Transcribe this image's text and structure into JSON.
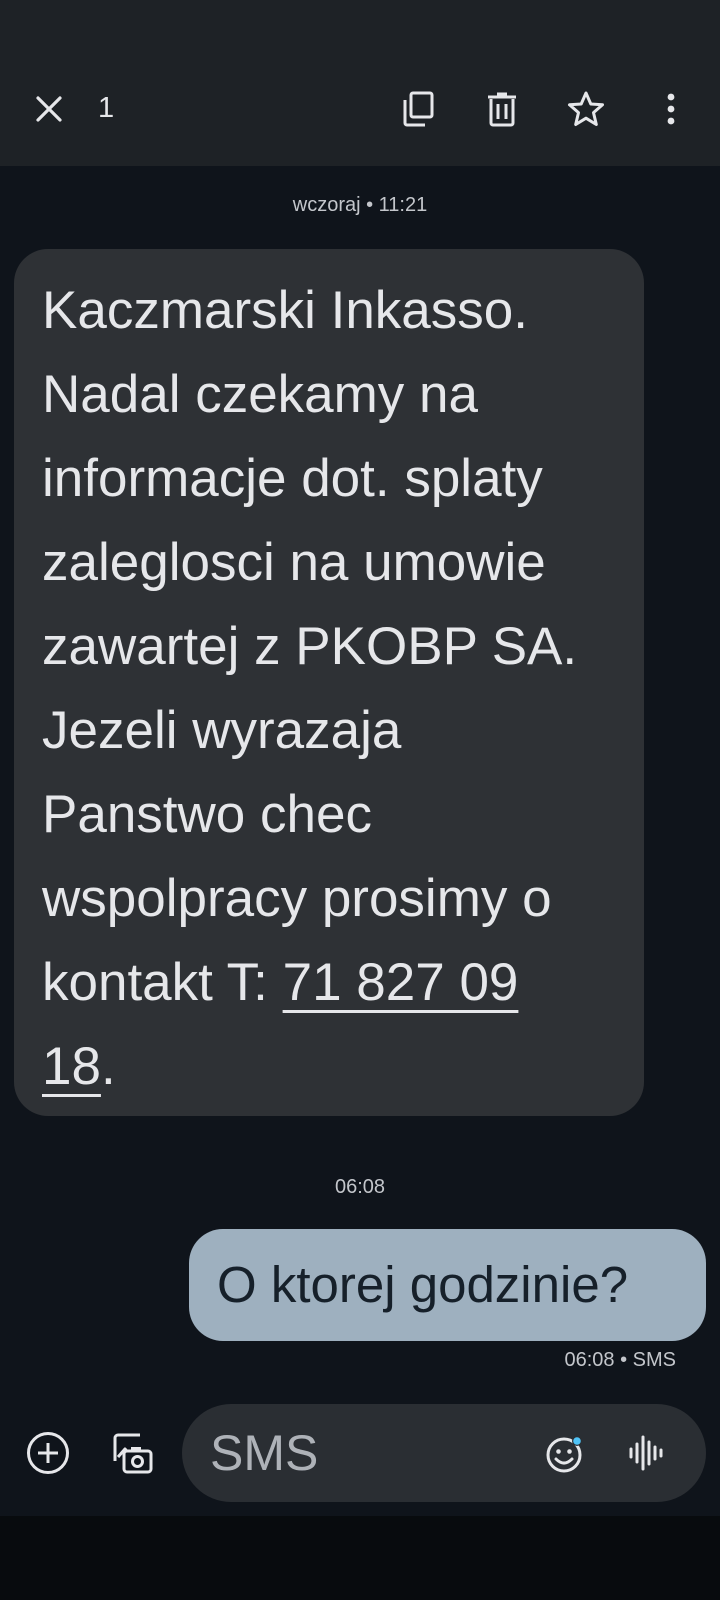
{
  "header": {
    "selected_count": "1",
    "icons": {
      "close": "close-icon",
      "copy": "copy-icon",
      "delete": "delete-icon",
      "star": "star-icon",
      "more": "more-vert-icon"
    }
  },
  "conversation": {
    "incoming": {
      "timestamp": "wczoraj • 11:21",
      "text_before_link": "Kaczmarski Inkasso. Nadal czekamy na informacje dot. splaty zaleglosci na umowie zawartej z PKOBP SA. Jezeli wyrazaja Panstwo chec wspolpracy prosimy o kontakt T: ",
      "phone_link": "71 827 09 18",
      "text_after_link": "."
    },
    "outgoing": {
      "timestamp": "06:08",
      "text": "O ktorej godzinie?",
      "meta": "06:08 • SMS"
    }
  },
  "composer": {
    "placeholder": "SMS",
    "icons": {
      "add": "add-circle-icon",
      "gallery": "gallery-icon",
      "emoji": "emoji-icon",
      "voice": "voice-waveform-icon"
    }
  },
  "colors": {
    "background": "#0f141b",
    "bar": "#1e2226",
    "incoming_bubble": "#2e3135",
    "outgoing_bubble": "#9eb0bf",
    "accent_dot": "#4fc3f7"
  }
}
